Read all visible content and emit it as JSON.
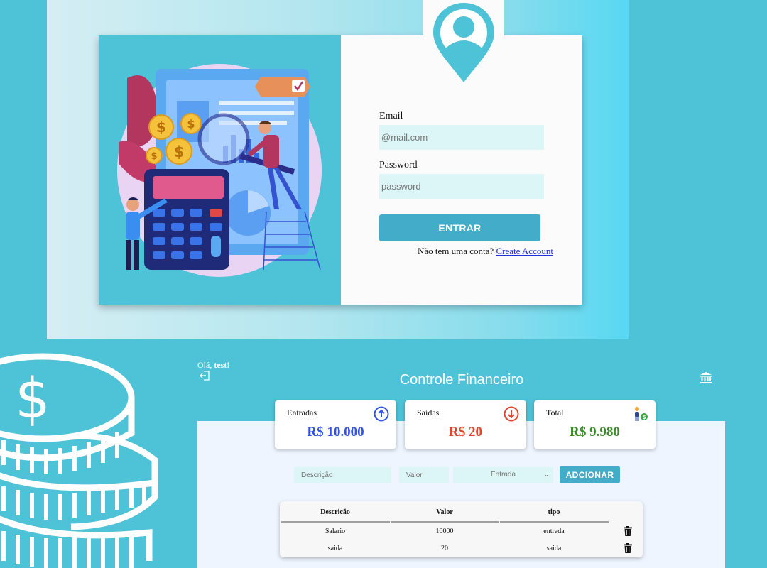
{
  "login": {
    "email_label": "Email",
    "email_placeholder": "@mail.com",
    "password_label": "Password",
    "password_placeholder": "password",
    "submit_label": "ENTRAR",
    "signup_prompt": "Não tem uma conta?",
    "signup_link": "Create Account"
  },
  "dashboard": {
    "greeting_prefix": "Olá,",
    "username": "test!",
    "title": "Controle Financeiro",
    "cards": [
      {
        "label": "Entradas",
        "value": "R$ 10.000",
        "color": "#3353e6",
        "icon": "arrow-up-circle-icon"
      },
      {
        "label": "Saídas",
        "value": "R$ 20",
        "color": "#e0442c",
        "icon": "arrow-down-circle-icon"
      },
      {
        "label": "Total",
        "value": "R$ 9.980",
        "color": "#3a8a28",
        "icon": "person-money-icon"
      }
    ],
    "form": {
      "description_placeholder": "Descrição",
      "value_placeholder": "Valor",
      "type_selected": "Entrada",
      "add_label": "ADCIONAR"
    },
    "table": {
      "headers": [
        "Descricão",
        "Valor",
        "tipo"
      ],
      "rows": [
        {
          "descricao": "Salario",
          "valor": "10000",
          "tipo": "entrada"
        },
        {
          "descricao": "saida",
          "valor": "20",
          "tipo": "saida"
        }
      ]
    }
  },
  "colors": {
    "accent": "#4ec3d8",
    "button": "#42acc9",
    "input_bg": "#dcf5f7"
  }
}
